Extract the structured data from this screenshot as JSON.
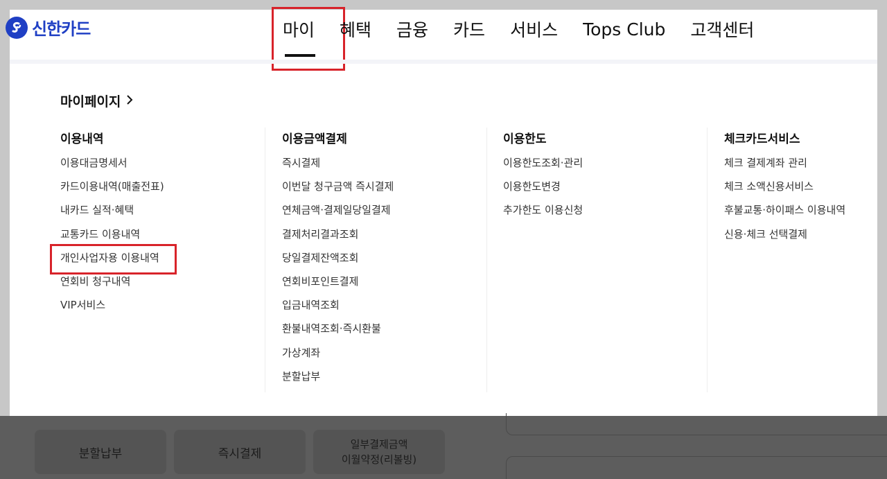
{
  "logo": {
    "text": "신한카드"
  },
  "nav": {
    "items": [
      "마이",
      "혜택",
      "금융",
      "카드",
      "서비스",
      "Tops Club",
      "고객센터"
    ],
    "active_index": 0
  },
  "mypage_link": {
    "label": "마이페이지",
    "chevron": "chevron-right-icon"
  },
  "columns": [
    {
      "title": "이용내역",
      "items": [
        "이용대금명세서",
        "카드이용내역(매출전표)",
        "내카드 실적·혜택",
        "교통카드 이용내역",
        "개인사업자용 이용내역",
        "연회비 청구내역",
        "VIP서비스"
      ]
    },
    {
      "title": "이용금액결제",
      "items": [
        "즉시결제",
        "이번달 청구금액 즉시결제",
        "연체금액·결제일당일결제",
        "결제처리결과조회",
        "당일결제잔액조회",
        "연회비포인트결제",
        "입금내역조회",
        "환불내역조회·즉시환불",
        "가상계좌",
        "분할납부"
      ]
    },
    {
      "title": "이용한도",
      "items": [
        "이용한도조회·관리",
        "이용한도변경",
        "추가한도 이용신청"
      ]
    },
    {
      "title": "체크카드서비스",
      "items": [
        "체크 결제계좌 관리",
        "체크 소액신용서비스",
        "후불교통·하이패스 이용내역",
        "신용·체크 선택결제"
      ]
    }
  ],
  "background_buttons": {
    "installment": "분할납부",
    "instant": "즉시결제",
    "revolving_line1": "일부결제금액",
    "revolving_line2": "이월약정(리볼빙)"
  },
  "colors": {
    "brand": "#1f3fc4",
    "highlight": "#d8232a",
    "overlay": "#5d5d5d"
  }
}
